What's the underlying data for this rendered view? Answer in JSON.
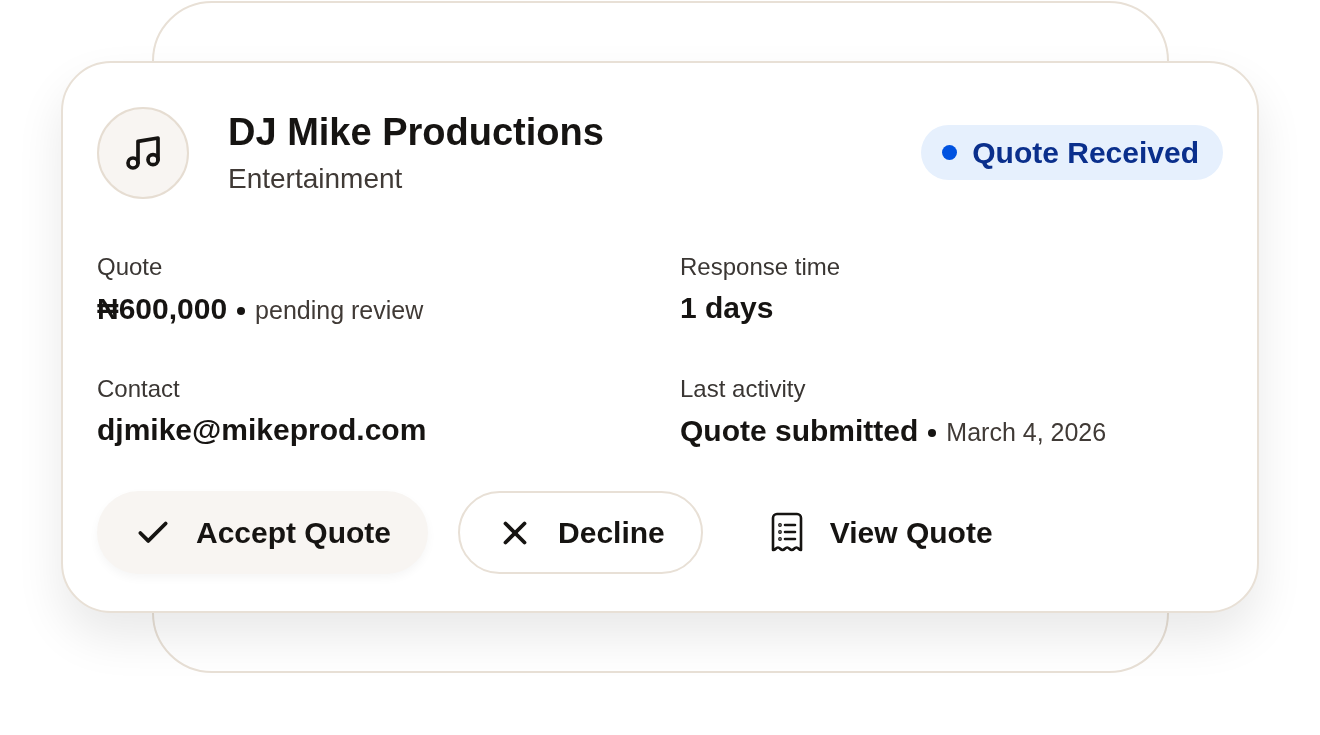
{
  "vendor": {
    "name": "DJ Mike Productions",
    "category": "Entertainment"
  },
  "status_badge": {
    "label": "Quote Received"
  },
  "details": [
    {
      "label": "Quote",
      "value": "₦600,000",
      "note": "pending review"
    },
    {
      "label": "Response time",
      "value": "1 days"
    },
    {
      "label": "Contact",
      "value": "djmike@mikeprod.com"
    },
    {
      "label": "Last activity",
      "value": "Quote submitted",
      "note": "March 4, 2026"
    }
  ],
  "actions": [
    {
      "label": "Accept Quote",
      "kind": "accept"
    },
    {
      "label": "Decline",
      "kind": "decline"
    },
    {
      "label": "View Quote",
      "kind": "view"
    }
  ]
}
